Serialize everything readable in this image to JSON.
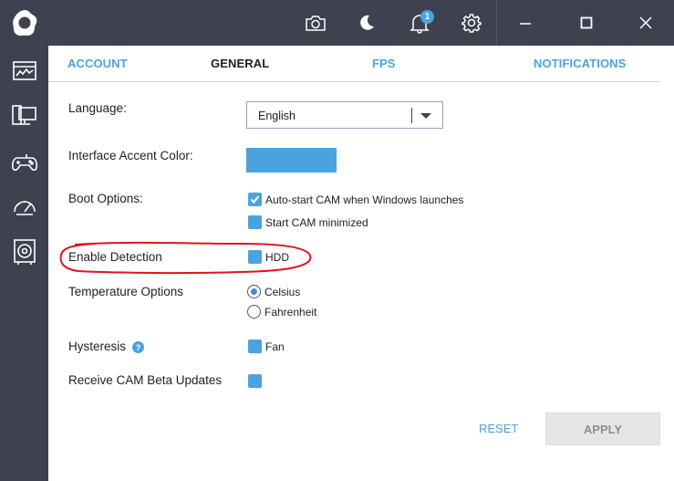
{
  "app": {
    "logo_icon": "cam-logo-icon",
    "accent_color": "#4aa3df"
  },
  "sidebar": {
    "items": [
      {
        "icon": "dashboard-icon"
      },
      {
        "icon": "pc-monitor-icon"
      },
      {
        "icon": "gamepad-icon"
      },
      {
        "icon": "speedometer-icon"
      },
      {
        "icon": "speaker-icon"
      }
    ]
  },
  "topbar": {
    "icons": [
      "camera-icon",
      "moon-icon",
      "bell-icon",
      "gear-icon"
    ],
    "notification_count": "1",
    "window_controls": [
      "minimize-icon",
      "maximize-icon",
      "close-icon"
    ]
  },
  "tabs": [
    {
      "label": "ACCOUNT",
      "active": false
    },
    {
      "label": "GENERAL",
      "active": true
    },
    {
      "label": "FPS",
      "active": false
    },
    {
      "label": "NOTIFICATIONS",
      "active": false
    }
  ],
  "settings": {
    "language": {
      "label": "Language:",
      "value": "English"
    },
    "accent_color": {
      "label": "Interface Accent Color:",
      "color": "#4aa3df"
    },
    "boot": {
      "label": "Boot Options:",
      "options": [
        {
          "label": "Auto-start CAM when Windows launches",
          "checked": true
        },
        {
          "label": "Start CAM minimized",
          "checked": false
        }
      ]
    },
    "detection": {
      "label": "Enable Detection",
      "option": "HDD",
      "checked": false
    },
    "temperature": {
      "label": "Temperature Options",
      "options": [
        {
          "label": "Celsius",
          "selected": true
        },
        {
          "label": "Fahrenheit",
          "selected": false
        }
      ]
    },
    "hysteresis": {
      "label": "Hysteresis",
      "help_icon": "question-icon",
      "option": "Fan",
      "checked": false
    },
    "beta": {
      "label": "Receive CAM Beta Updates",
      "checked": false
    }
  },
  "actions": {
    "reset": "RESET",
    "apply": "APPLY"
  },
  "annotation": {
    "color": "#e0141e"
  }
}
